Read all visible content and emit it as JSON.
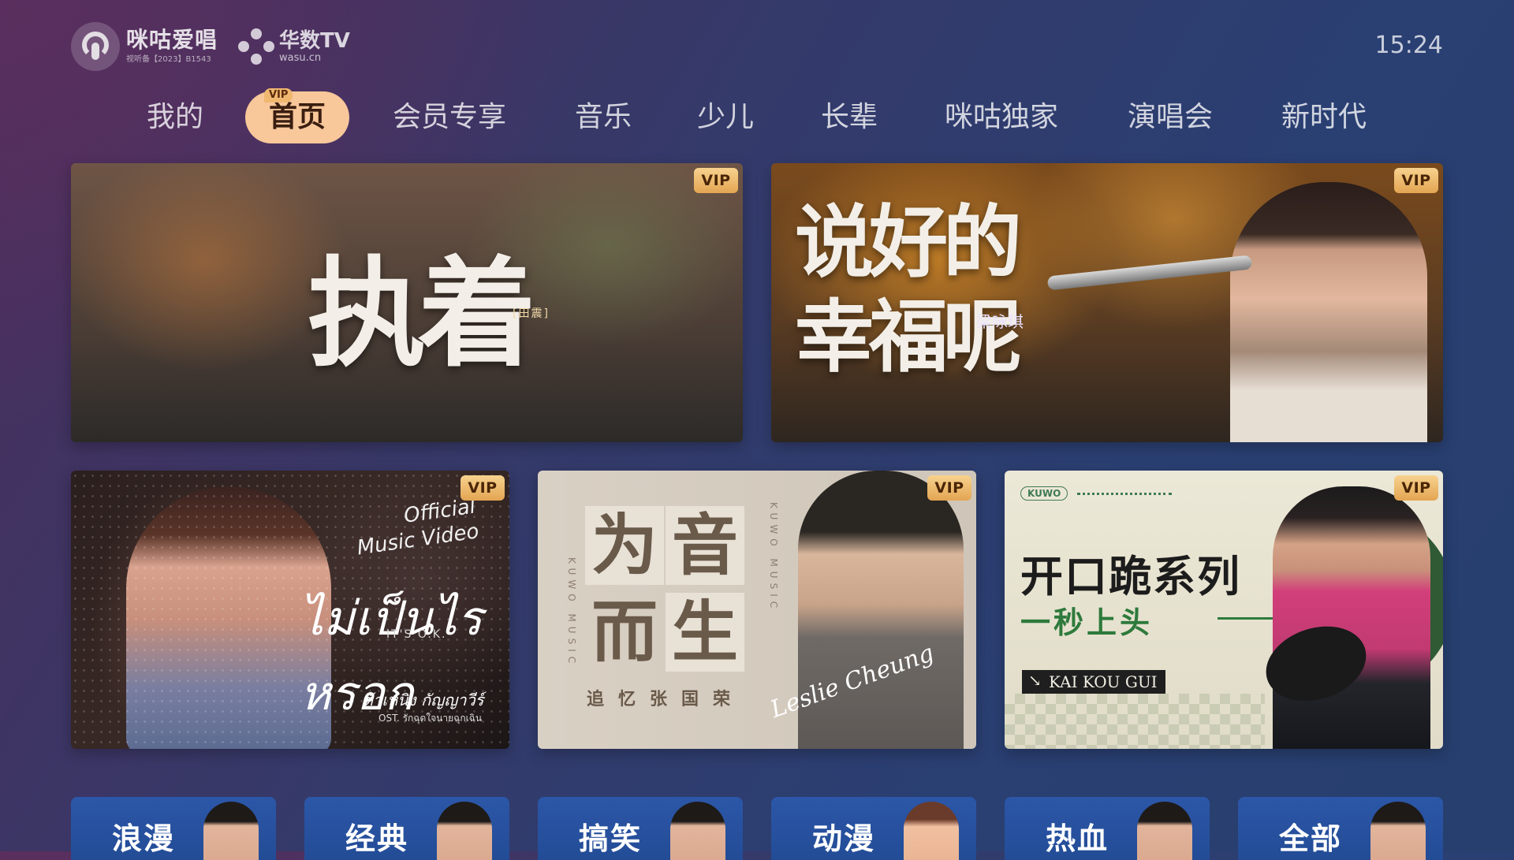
{
  "header": {
    "brand_name": "咪咕爱唱",
    "brand_license": "视听备【2023】B1543",
    "partner_name": "华数TV",
    "partner_domain": "wasu.cn",
    "clock": "15:24"
  },
  "nav": {
    "active_index": 1,
    "items": [
      {
        "label": "我的"
      },
      {
        "label": "首页",
        "badge": "VIP"
      },
      {
        "label": "会员专享"
      },
      {
        "label": "音乐"
      },
      {
        "label": "少儿"
      },
      {
        "label": "长辈"
      },
      {
        "label": "咪咕独家"
      },
      {
        "label": "演唱会"
      },
      {
        "label": "新时代"
      }
    ]
  },
  "banners": [
    {
      "badge": "VIP",
      "title": "执着",
      "artist": "[田震]"
    },
    {
      "badge": "VIP",
      "title": "说好的幸福呢",
      "artist": "梁咏琪"
    },
    {
      "badge": "VIP",
      "over_line1": "Official",
      "over_line2": "Music Video",
      "title": "ไม่เป็นไรหรอก",
      "subtitle": "IT'S O.K.",
      "credit": "ต้าเหนิง กัญญาวีร์",
      "ost": "OST. รักฉุดใจนายฉุกเฉิน"
    },
    {
      "badge": "VIP",
      "tiles": [
        "为",
        "音",
        "而",
        "生"
      ],
      "caption": "追忆张国荣",
      "side_text": "KUWO MUSIC",
      "signature": "Leslie Cheung"
    },
    {
      "badge": "VIP",
      "brand": "KUWO",
      "headline": "开口跪系列",
      "subline": "一秒上头",
      "tag": "KAI KOU GUI"
    }
  ],
  "categories": [
    {
      "label": "浪漫"
    },
    {
      "label": "经典"
    },
    {
      "label": "搞笑"
    },
    {
      "label": "动漫"
    },
    {
      "label": "热血"
    },
    {
      "label": "全部"
    }
  ],
  "colors": {
    "accent_active_tab": "#f8c79a",
    "vip_gold": "#e3a552",
    "category_blue": "#2c57a8"
  }
}
